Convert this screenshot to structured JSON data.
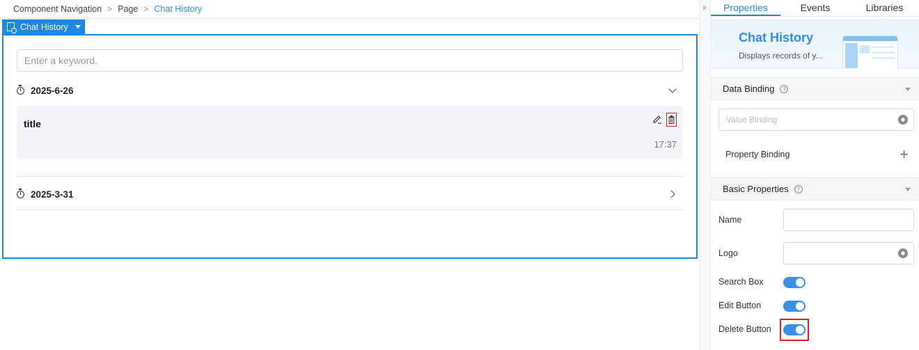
{
  "breadcrumb": {
    "items": [
      "Component Navigation",
      "Page"
    ],
    "current": "Chat History"
  },
  "component_tag": {
    "label": "Chat History"
  },
  "chat": {
    "search_placeholder": "Enter a keyword.",
    "groups": [
      {
        "date": "2025-6-26",
        "expanded": true
      },
      {
        "date": "2025-3-31",
        "expanded": false
      }
    ],
    "item": {
      "title": "title",
      "time": "17:37"
    }
  },
  "panel": {
    "tabs": [
      "Properties",
      "Events",
      "Libraries"
    ],
    "active_tab": "Properties",
    "hero": {
      "title": "Chat History",
      "description": "Displays records of y..."
    },
    "data_binding": {
      "title": "Data Binding",
      "value_binding_placeholder": "Value Binding",
      "property_binding_label": "Property Binding"
    },
    "basic": {
      "title": "Basic Properties",
      "name_label": "Name",
      "logo_label": "Logo",
      "search_box_label": "Search Box",
      "edit_button_label": "Edit Button",
      "delete_button_label": "Delete Button",
      "search_box_on": true,
      "edit_button_on": true,
      "delete_button_on": true
    }
  },
  "colors": {
    "accent": "#1e88e5",
    "highlight": "#e02020",
    "toggle_on": "#3a8ee6"
  }
}
